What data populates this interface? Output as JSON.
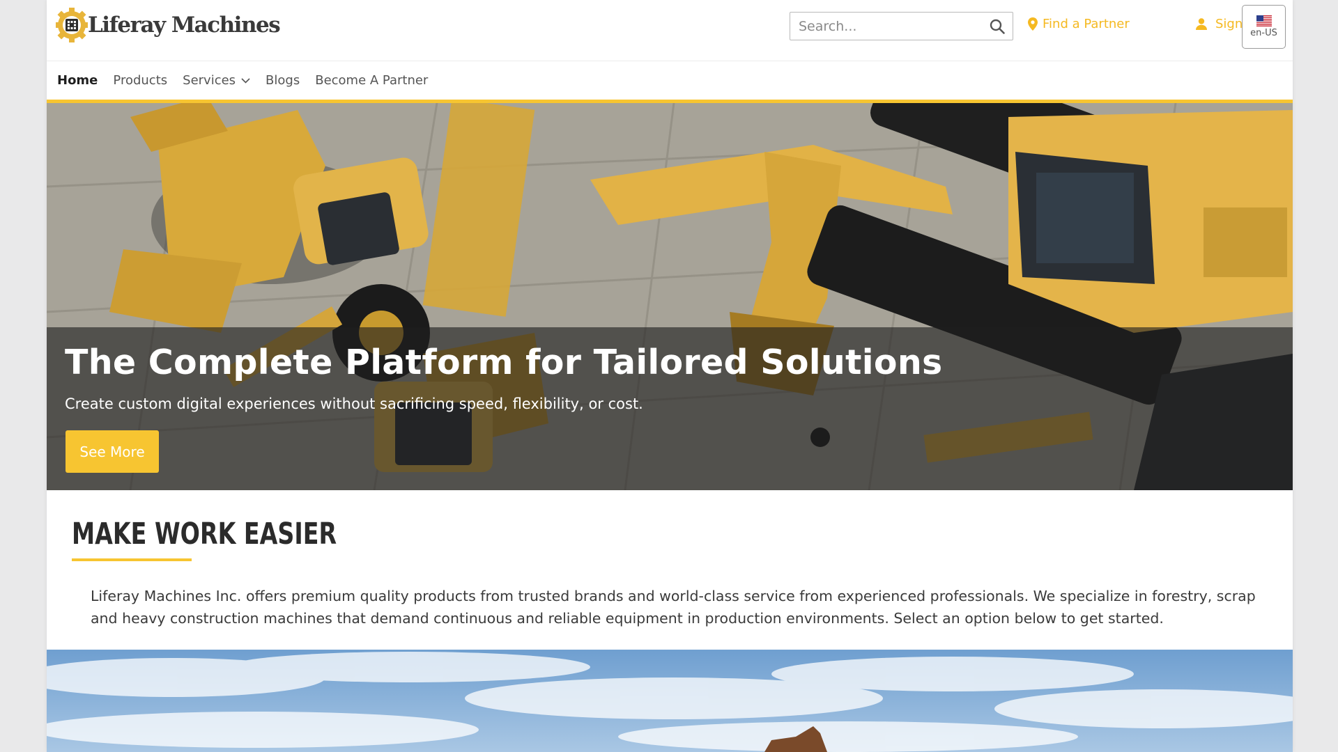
{
  "brand": {
    "name": "Liferay Machines",
    "accent": "#f7c531"
  },
  "header": {
    "search_placeholder": "Search...",
    "find_partner": "Find a Partner",
    "sign_in": "Sign In",
    "language": "en-US"
  },
  "nav": {
    "items": [
      "Home",
      "Products",
      "Services",
      "Blogs",
      "Become A Partner"
    ],
    "active": "Home"
  },
  "hero": {
    "title": "The Complete Platform for Tailored Solutions",
    "subtitle": "Create custom digital experiences without sacrificing speed, flexibility, or cost.",
    "button": "See More"
  },
  "section": {
    "title": "MAKE WORK EASIER",
    "body": "Liferay Machines Inc. offers premium quality products from trusted brands and world-class service from experienced professionals. We specialize in forestry, scrap and heavy construction machines that demand continuous and reliable equipment in production environments. Select an option below to get started."
  },
  "icons": [
    "gear-logo-icon",
    "search-icon",
    "map-pin-icon",
    "user-icon",
    "us-flag-icon",
    "chevron-down-icon"
  ]
}
